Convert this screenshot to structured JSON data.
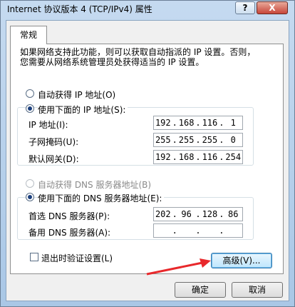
{
  "window": {
    "title": "Internet 协议版本 4 (TCP/IPv4) 属性",
    "help_label": "?",
    "close_label": "X"
  },
  "tab": {
    "label": "常规"
  },
  "intro": {
    "line1": "如果网络支持此功能，则可以获取自动指派的 IP 设置。否则，",
    "line2": "您需要从网络系统管理员处获得适当的 IP 设置。"
  },
  "ip_mode": {
    "auto_label": "自动获得 IP 地址(O)",
    "manual_label": "使用下面的 IP 地址(S):",
    "selected": "manual"
  },
  "ip_fields": [
    {
      "label": "IP 地址(I):",
      "octets": [
        "192",
        "168",
        "116",
        "1"
      ]
    },
    {
      "label": "子网掩码(U):",
      "octets": [
        "255",
        "255",
        "255",
        "0"
      ]
    },
    {
      "label": "默认网关(D):",
      "octets": [
        "192",
        "168",
        "116",
        "254"
      ]
    }
  ],
  "dns_mode": {
    "auto_label": "自动获得 DNS 服务器地址(B)",
    "manual_label": "使用下面的 DNS 服务器地址(E):",
    "selected": "manual"
  },
  "dns_fields": [
    {
      "label": "首选 DNS 服务器(P):",
      "octets": [
        "202",
        "96",
        "128",
        "86"
      ]
    },
    {
      "label": "备用 DNS 服务器(A):",
      "octets": [
        "",
        "",
        "",
        ""
      ]
    }
  ],
  "validate": {
    "label": "退出时验证设置(L)",
    "checked": false
  },
  "buttons": {
    "advanced": "高级(V)...",
    "ok": "确定",
    "cancel": "取消"
  },
  "colors": {
    "annotation_arrow": "#e8282b",
    "selected_radio": "#1b3f7d"
  }
}
